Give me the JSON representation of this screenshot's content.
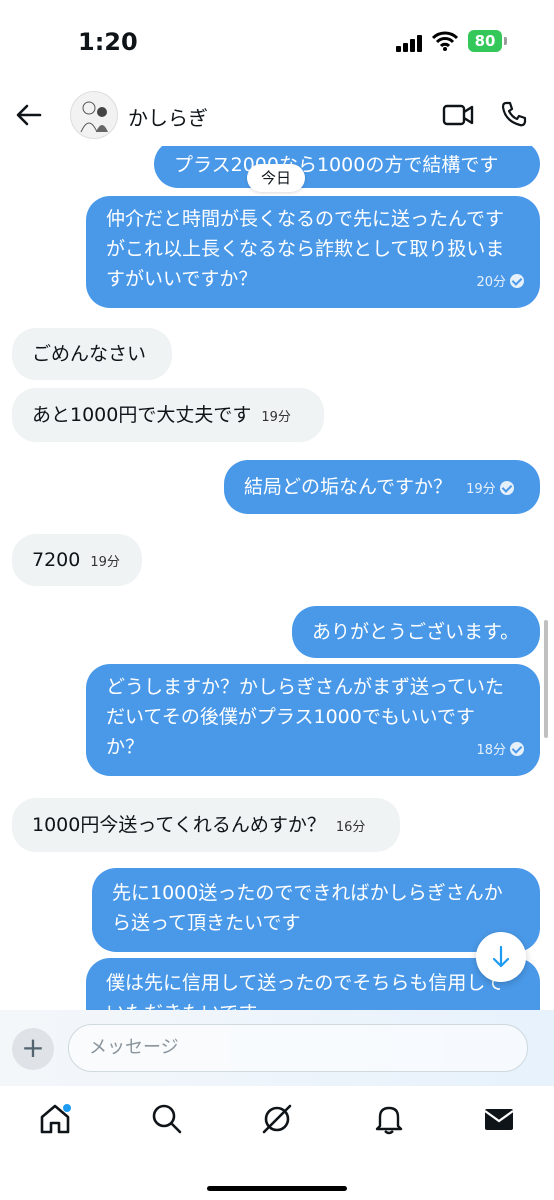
{
  "status": {
    "time": "1:20",
    "battery": "80"
  },
  "header": {
    "contact_name": "かしらぎ"
  },
  "chat": {
    "date_label": "今日",
    "messages": [
      {
        "dir": "out",
        "lines": [
          "プラス2000なら1000の方で結構です"
        ],
        "time": ""
      },
      {
        "dir": "out",
        "lines": [
          "仲介だと時間が長くなるので先に送ったんです",
          "がこれ以上長くなるなら詐欺として取り扱いま",
          "すがいいですか？"
        ],
        "time": "20分"
      },
      {
        "dir": "in",
        "lines": [
          "ごめんなさい"
        ],
        "time": ""
      },
      {
        "dir": "in",
        "lines": [
          "あと1000円で大丈夫です"
        ],
        "time": "19分"
      },
      {
        "dir": "out",
        "lines": [
          "結局どの垢なんですか？"
        ],
        "time": "19分"
      },
      {
        "dir": "in",
        "lines": [
          "7200"
        ],
        "time": "19分"
      },
      {
        "dir": "out",
        "lines": [
          "ありがとうございます。"
        ],
        "time": ""
      },
      {
        "dir": "out",
        "lines": [
          "どうしますか？かしらぎさんがまず送っていた",
          "だいてその後僕がプラス1000でもいいです",
          "か？"
        ],
        "time": "18分"
      },
      {
        "dir": "in",
        "lines": [
          "1000円今送ってくれるんめすか？"
        ],
        "time": "16分"
      },
      {
        "dir": "out",
        "lines": [
          "先に1000送ったのでできればかしらぎさんか",
          "ら送って頂きたいです"
        ],
        "time": ""
      },
      {
        "dir": "out",
        "lines": [
          "僕は先に信用して送ったのでそちらも信用して",
          "いただきたいです"
        ],
        "time": ""
      }
    ]
  },
  "composer": {
    "placeholder": "メッセージ"
  },
  "colors": {
    "outgoing": "#4a99e9",
    "incoming": "#eff3f4",
    "battery": "#34c759"
  }
}
